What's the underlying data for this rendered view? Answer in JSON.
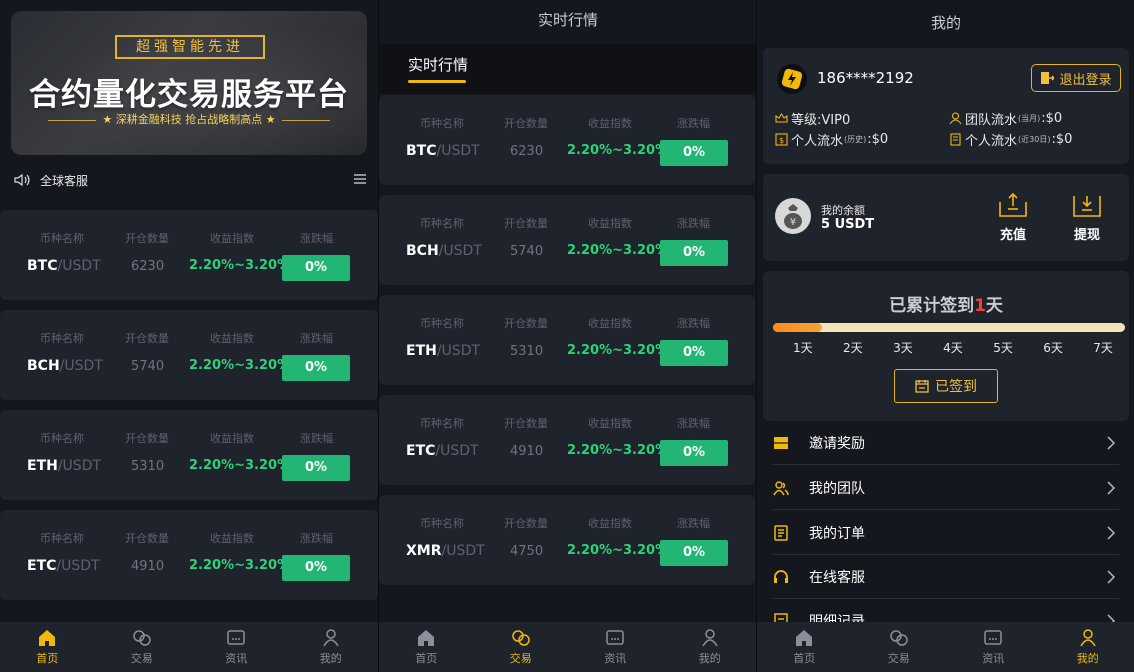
{
  "home": {
    "banner": {
      "tag": "超强智能先进",
      "title": "合约量化交易服务平台",
      "subtitle": "★ 深耕金融科技  抢占战略制高点 ★"
    },
    "notice": "全球客服",
    "columns": [
      "币种名称",
      "开仓数量",
      "收益指数",
      "涨跌幅"
    ],
    "rows": [
      {
        "base": "BTC",
        "quote": "/USDT",
        "qty": "6230",
        "rate": "2.20%~3.20%",
        "change": "0%"
      },
      {
        "base": "BCH",
        "quote": "/USDT",
        "qty": "5740",
        "rate": "2.20%~3.20%",
        "change": "0%"
      },
      {
        "base": "ETH",
        "quote": "/USDT",
        "qty": "5310",
        "rate": "2.20%~3.20%",
        "change": "0%"
      },
      {
        "base": "ETC",
        "quote": "/USDT",
        "qty": "4910",
        "rate": "2.20%~3.20%",
        "change": "0%"
      }
    ]
  },
  "market": {
    "title": "实时行情",
    "tab": "实时行情",
    "rows": [
      {
        "base": "BTC",
        "quote": "/USDT",
        "qty": "6230",
        "rate": "2.20%~3.20%",
        "change": "0%"
      },
      {
        "base": "BCH",
        "quote": "/USDT",
        "qty": "5740",
        "rate": "2.20%~3.20%",
        "change": "0%"
      },
      {
        "base": "ETH",
        "quote": "/USDT",
        "qty": "5310",
        "rate": "2.20%~3.20%",
        "change": "0%"
      },
      {
        "base": "ETC",
        "quote": "/USDT",
        "qty": "4910",
        "rate": "2.20%~3.20%",
        "change": "0%"
      },
      {
        "base": "XMR",
        "quote": "/USDT",
        "qty": "4750",
        "rate": "2.20%~3.20%",
        "change": "0%"
      }
    ]
  },
  "profile": {
    "title": "我的",
    "phone": "186****2192",
    "logout": "退出登录",
    "level": "等级:VIP0",
    "team_flow_label": "团队流水",
    "team_flow_tag": "(当月)",
    "team_flow_value": ":$0",
    "personal_flow_label": "个人流水",
    "personal_flow_tag": "(历史)",
    "personal_flow_value": ":$0",
    "personal_flow30_label": "个人流水",
    "personal_flow30_tag": "(近30日)",
    "personal_flow30_value": ":$0",
    "balance_label": "我的余额",
    "balance_value": "5 USDT",
    "deposit": "充值",
    "withdraw": "提现",
    "sign_prefix": "已累计签到",
    "sign_count": "1",
    "sign_suffix": "天",
    "sign_progress": 0.14,
    "days": [
      "1天",
      "2天",
      "3天",
      "4天",
      "5天",
      "6天",
      "7天"
    ],
    "signed_button": "已签到",
    "menu": [
      "邀请奖励",
      "我的团队",
      "我的订单",
      "在线客服",
      "明细记录"
    ]
  },
  "tabbar": [
    "首页",
    "交易",
    "资讯",
    "我的"
  ],
  "colors": {
    "accent": "#f0b90b",
    "up": "#22b573",
    "rate": "#2ed07a",
    "card": "#1f232b",
    "bg": "#14171d"
  }
}
